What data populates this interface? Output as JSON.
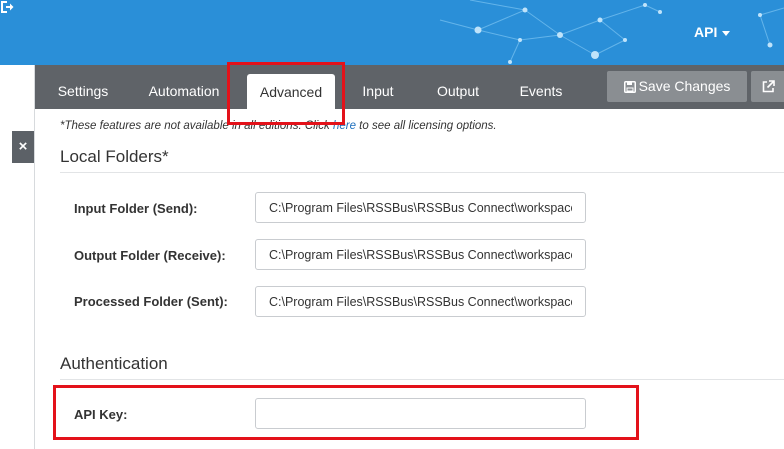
{
  "header": {
    "api_menu_label": "API",
    "logout_icon": "sign-out-icon"
  },
  "sidebar": {
    "close_label": "×"
  },
  "tabs": [
    {
      "label": "Settings"
    },
    {
      "label": "Automation"
    },
    {
      "label": "Advanced",
      "active": true
    },
    {
      "label": "Input"
    },
    {
      "label": "Output"
    },
    {
      "label": "Events"
    }
  ],
  "toolbar": {
    "save_label": "Save Changes",
    "save_icon": "save-icon",
    "external_icon": "external-link-icon"
  },
  "notice": {
    "text_before": "*These features are not available in all editions. Click ",
    "link_text": "here",
    "text_after": " to see all licensing options."
  },
  "local_folders": {
    "title": "Local Folders*",
    "fields": [
      {
        "label": "Input Folder (Send):",
        "value": "C:\\Program Files\\RSSBus\\RSSBus Connect\\workspaces"
      },
      {
        "label": "Output Folder (Receive):",
        "value": "C:\\Program Files\\RSSBus\\RSSBus Connect\\workspaces"
      },
      {
        "label": "Processed Folder (Sent):",
        "value": "C:\\Program Files\\RSSBus\\RSSBus Connect\\workspaces"
      }
    ]
  },
  "authentication": {
    "title": "Authentication",
    "api_key_label": "API Key:",
    "api_key_value": ""
  },
  "colors": {
    "header": "#2a8fd8",
    "tabbar": "#5f6368",
    "highlight": "#e3121a"
  }
}
